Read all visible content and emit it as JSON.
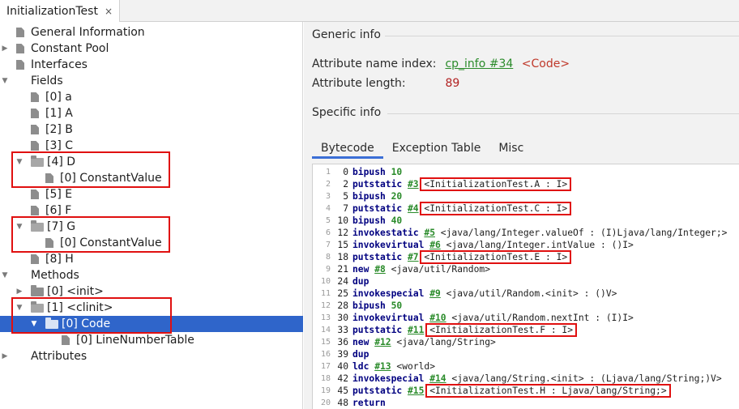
{
  "tab": {
    "title": "InitializationTest",
    "close": "×"
  },
  "tree": [
    {
      "label": "General Information",
      "level": 0,
      "arrow": "",
      "icon": "file",
      "selected": false
    },
    {
      "label": "Constant Pool",
      "level": 0,
      "arrow": "▶",
      "icon": "file",
      "selected": false
    },
    {
      "label": "Interfaces",
      "level": 0,
      "arrow": "",
      "icon": "file",
      "selected": false
    },
    {
      "label": "Fields",
      "level": 0,
      "arrow": "▼",
      "icon": "none",
      "selected": false
    },
    {
      "label": "[0] a",
      "level": 1,
      "arrow": "",
      "icon": "file",
      "selected": false
    },
    {
      "label": "[1] A",
      "level": 1,
      "arrow": "",
      "icon": "file",
      "selected": false
    },
    {
      "label": "[2] B",
      "level": 1,
      "arrow": "",
      "icon": "file",
      "selected": false
    },
    {
      "label": "[3] C",
      "level": 1,
      "arrow": "",
      "icon": "file",
      "selected": false
    },
    {
      "label": "[4] D",
      "level": 1,
      "arrow": "▼",
      "icon": "folder-open",
      "selected": false
    },
    {
      "label": "[0] ConstantValue",
      "level": 2,
      "arrow": "",
      "icon": "file",
      "selected": false
    },
    {
      "label": "[5] E",
      "level": 1,
      "arrow": "",
      "icon": "file",
      "selected": false
    },
    {
      "label": "[6] F",
      "level": 1,
      "arrow": "",
      "icon": "file",
      "selected": false
    },
    {
      "label": "[7] G",
      "level": 1,
      "arrow": "▼",
      "icon": "folder-open",
      "selected": false
    },
    {
      "label": "[0] ConstantValue",
      "level": 2,
      "arrow": "",
      "icon": "file",
      "selected": false
    },
    {
      "label": "[8] H",
      "level": 1,
      "arrow": "",
      "icon": "file",
      "selected": false
    },
    {
      "label": "Methods",
      "level": 0,
      "arrow": "▼",
      "icon": "none",
      "selected": false
    },
    {
      "label": "[0] <init>",
      "level": 1,
      "arrow": "▶",
      "icon": "folder",
      "selected": false
    },
    {
      "label": "[1] <clinit>",
      "level": 1,
      "arrow": "▼",
      "icon": "folder-open",
      "selected": false
    },
    {
      "label": "[0] Code",
      "level": 2,
      "arrow": "▼",
      "icon": "folder-open",
      "selected": true
    },
    {
      "label": "[0] LineNumberTable",
      "level": 3,
      "arrow": "",
      "icon": "file",
      "selected": false
    },
    {
      "label": "Attributes",
      "level": 0,
      "arrow": "▶",
      "icon": "none",
      "selected": false
    }
  ],
  "generic": {
    "title": "Generic info",
    "name_index_label": "Attribute name index:",
    "name_index_link": "cp_info #34",
    "name_index_value": "<Code>",
    "length_label": "Attribute length:",
    "length_value": "89"
  },
  "specific": {
    "title": "Specific info"
  },
  "subtabs": [
    "Bytecode",
    "Exception Table",
    "Misc"
  ],
  "bytecode": [
    {
      "line": "1",
      "offset": "0",
      "instr": "bipush",
      "num": "10"
    },
    {
      "line": "2",
      "offset": "2",
      "instr": "putstatic",
      "cp": "#3",
      "text": "<InitializationTest.A : I>",
      "boxed": true
    },
    {
      "line": "3",
      "offset": "5",
      "instr": "bipush",
      "num": "20"
    },
    {
      "line": "4",
      "offset": "7",
      "instr": "putstatic",
      "cp": "#4",
      "text": "<InitializationTest.C : I>",
      "boxed": true
    },
    {
      "line": "5",
      "offset": "10",
      "instr": "bipush",
      "num": "40"
    },
    {
      "line": "6",
      "offset": "12",
      "instr": "invokestatic",
      "cp": "#5",
      "text": "<java/lang/Integer.valueOf : (I)Ljava/lang/Integer;>"
    },
    {
      "line": "7",
      "offset": "15",
      "instr": "invokevirtual",
      "cp": "#6",
      "text": "<java/lang/Integer.intValue : ()I>"
    },
    {
      "line": "8",
      "offset": "18",
      "instr": "putstatic",
      "cp": "#7",
      "text": "<InitializationTest.E : I>",
      "boxed": true
    },
    {
      "line": "9",
      "offset": "21",
      "instr": "new",
      "cp": "#8",
      "text": "<java/util/Random>"
    },
    {
      "line": "10",
      "offset": "24",
      "instr": "dup"
    },
    {
      "line": "11",
      "offset": "25",
      "instr": "invokespecial",
      "cp": "#9",
      "text": "<java/util/Random.<init> : ()V>"
    },
    {
      "line": "12",
      "offset": "28",
      "instr": "bipush",
      "num": "50"
    },
    {
      "line": "13",
      "offset": "30",
      "instr": "invokevirtual",
      "cp": "#10",
      "text": "<java/util/Random.nextInt : (I)I>"
    },
    {
      "line": "14",
      "offset": "33",
      "instr": "putstatic",
      "cp": "#11",
      "text": "<InitializationTest.F : I>",
      "boxed": true
    },
    {
      "line": "15",
      "offset": "36",
      "instr": "new",
      "cp": "#12",
      "text": "<java/lang/String>"
    },
    {
      "line": "16",
      "offset": "39",
      "instr": "dup"
    },
    {
      "line": "17",
      "offset": "40",
      "instr": "ldc",
      "cp": "#13",
      "text": "<world>"
    },
    {
      "line": "18",
      "offset": "42",
      "instr": "invokespecial",
      "cp": "#14",
      "text": "<java/lang/String.<init> : (Ljava/lang/String;)V>"
    },
    {
      "line": "19",
      "offset": "45",
      "instr": "putstatic",
      "cp": "#15",
      "text": "<InitializationTest.H : Ljava/lang/String;>",
      "boxed": true
    },
    {
      "line": "20",
      "offset": "48",
      "instr": "return"
    }
  ]
}
